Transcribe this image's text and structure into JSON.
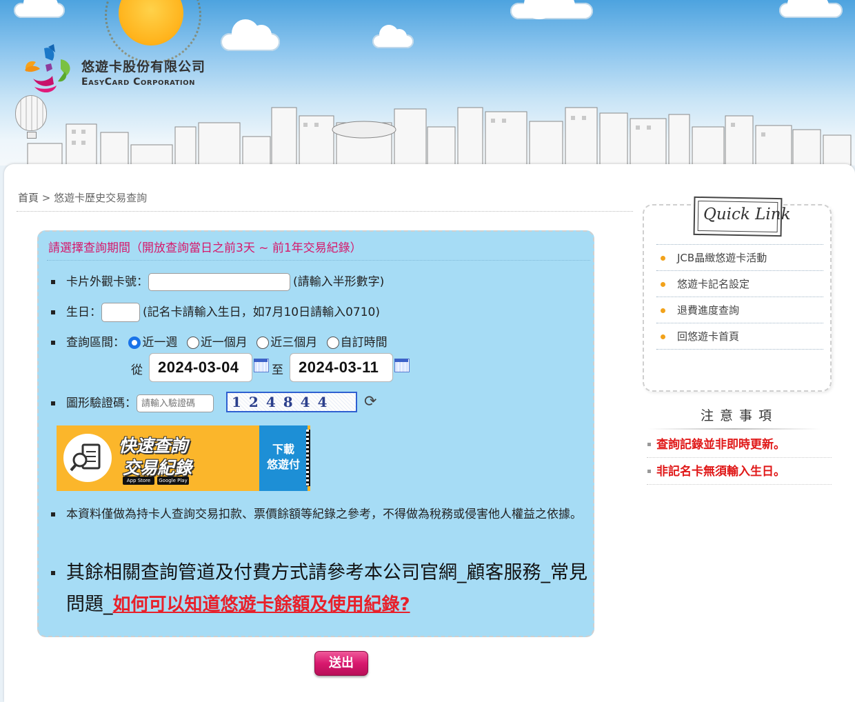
{
  "logo": {
    "name_cn": "悠遊卡股份有限公司",
    "name_en": "EasyCard Corporation"
  },
  "breadcrumb": {
    "home": "首頁",
    "separator": ">",
    "current": "悠遊卡歷史交易查詢"
  },
  "form": {
    "title": "請選擇查詢期間（開放查詢當日之前3天 ~ 前1年交易紀錄）",
    "card_number": {
      "label": "卡片外觀卡號：",
      "value": "",
      "hint": "(請輸入半形數字)"
    },
    "birthday": {
      "label": "生日：",
      "value": "",
      "hint": "(記名卡請輸入生日，如7月10日請輸入0710)"
    },
    "range": {
      "label": "查詢區間：",
      "options": [
        "近一週",
        "近一個月",
        "近三個月",
        "自訂時間"
      ],
      "selected": "近一週",
      "from_label": "從",
      "from_value": "2024-03-04",
      "to_label": "至",
      "to_value": "2024-03-11"
    },
    "captcha": {
      "label": "圖形驗證碼：",
      "placeholder": "請輸入驗證碼",
      "image_text": "124844"
    },
    "banner": {
      "line1": "快速查詢",
      "line2": "交易紀錄",
      "download_line1": "下載",
      "download_line2": "悠遊付",
      "app_store": "App Store",
      "google_play": "Google Play"
    },
    "note1": "本資料僅做為持卡人查詢交易扣款、票價餘額等紀錄之參考，不得做為稅務或侵害他人權益之依據。",
    "note2_prefix": "其餘相關查詢管道及付費方式請參考本公司官網_顧客服務_常見問題_",
    "note2_link": "如何可以知道悠遊卡餘額及使用紀錄?",
    "submit": "送出"
  },
  "quick_link": {
    "title": "Quick Link",
    "items": [
      "JCB晶緻悠遊卡活動",
      "悠遊卡記名設定",
      "退費進度查詢",
      "回悠遊卡首頁"
    ]
  },
  "notice": {
    "title": "注意事項",
    "items": [
      "查詢記錄並非即時更新。",
      "非記名卡無須輸入生日。"
    ]
  },
  "colors": {
    "accent_pink": "#d6186b",
    "form_bg": "#a6dcf5",
    "notice_red": "#e01818",
    "link_red": "#e8202a",
    "radio_blue": "#1a73e8"
  }
}
